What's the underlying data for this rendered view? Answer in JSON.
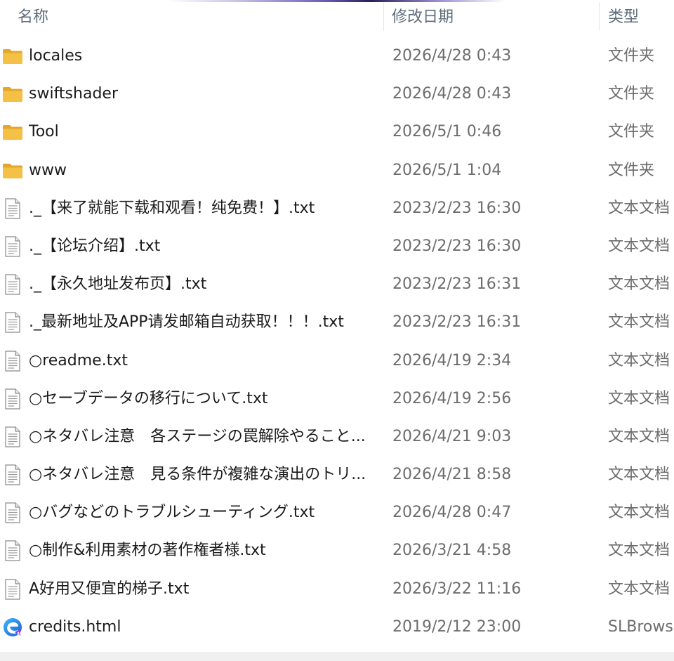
{
  "header": {
    "col_name": "名称",
    "col_date": "修改日期",
    "col_type": "类型"
  },
  "files": [
    {
      "icon": "folder-icon",
      "name": "locales",
      "date": "2026/4/28 0:43",
      "type": "文件夹"
    },
    {
      "icon": "folder-icon",
      "name": "swiftshader",
      "date": "2026/4/28 0:43",
      "type": "文件夹"
    },
    {
      "icon": "folder-icon",
      "name": "Tool",
      "date": "2026/5/1 0:46",
      "type": "文件夹"
    },
    {
      "icon": "folder-icon",
      "name": "www",
      "date": "2026/5/1 1:04",
      "type": "文件夹"
    },
    {
      "icon": "text-file-icon",
      "name": "._【来了就能下载和观看！纯免费！】.txt",
      "date": "2023/2/23 16:30",
      "type": "文本文档"
    },
    {
      "icon": "text-file-icon",
      "name": "._【论坛介绍】.txt",
      "date": "2023/2/23 16:30",
      "type": "文本文档"
    },
    {
      "icon": "text-file-icon",
      "name": "._【永久地址发布页】.txt",
      "date": "2023/2/23 16:31",
      "type": "文本文档"
    },
    {
      "icon": "text-file-icon",
      "name": "._最新地址及APP请发邮箱自动获取！！！.txt",
      "date": "2023/2/23 16:31",
      "type": "文本文档"
    },
    {
      "icon": "text-file-icon",
      "name": "○readme.txt",
      "date": "2026/4/19 2:34",
      "type": "文本文档"
    },
    {
      "icon": "text-file-icon",
      "name": "○セーブデータの移行について.txt",
      "date": "2026/4/19 2:56",
      "type": "文本文档"
    },
    {
      "icon": "text-file-icon",
      "name": "○ネタバレ注意　各ステージの罠解除やること...",
      "date": "2026/4/21 9:03",
      "type": "文本文档"
    },
    {
      "icon": "text-file-icon",
      "name": "○ネタバレ注意　見る条件が複雑な演出のトリ...",
      "date": "2026/4/21 8:58",
      "type": "文本文档"
    },
    {
      "icon": "text-file-icon",
      "name": "○バグなどのトラブルシューティング.txt",
      "date": "2026/4/28 0:47",
      "type": "文本文档"
    },
    {
      "icon": "text-file-icon",
      "name": "○制作&利用素材の著作権者様.txt",
      "date": "2026/3/21 4:58",
      "type": "文本文档"
    },
    {
      "icon": "text-file-icon",
      "name": "A好用又便宜的梯子.txt",
      "date": "2026/3/22 11:16",
      "type": "文本文档"
    },
    {
      "icon": "browser-html-icon",
      "name": "credits.html",
      "date": "2019/2/12 23:00",
      "type": "SLBrowser"
    }
  ],
  "colors": {
    "folder": "#f4c046",
    "folder_dark": "#e3a82b",
    "header_text": "#5e6c7a",
    "date_text": "#6d6d6d",
    "name_text": "#1b1b1b"
  }
}
